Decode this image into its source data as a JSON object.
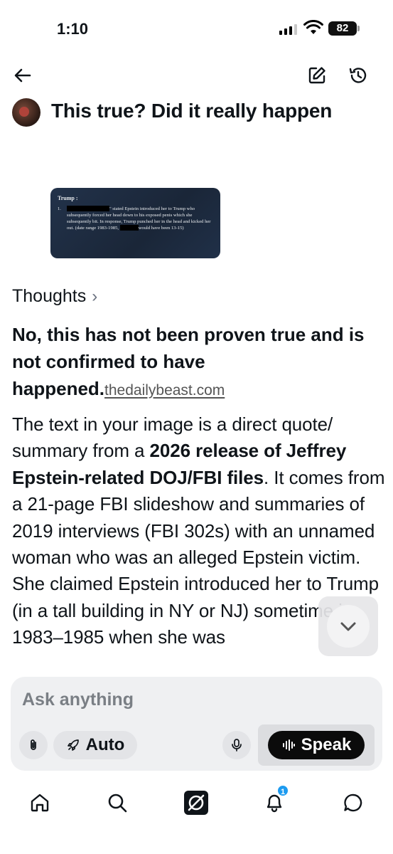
{
  "status_bar": {
    "time": "1:10",
    "battery": "82"
  },
  "header": {
    "title": "This true? Did it really happen"
  },
  "attached_image": {
    "heading": "Trump :",
    "item_number": "1.",
    "text_a": "\" stated Epstein introduced her to Trump who subsequently forced her head down to his exposed penis which she subsequently bit. In response, Trump punched her in the head and kicked her out. (date range 1983-1985,",
    "text_b": "would have been 13-15)"
  },
  "thoughts": {
    "label": "Thoughts",
    "chevron": "›"
  },
  "answer": {
    "headline": "No, this has not been proven true and is not confirmed to have happened.",
    "source_link": "thedailybeast.com",
    "body_1": "The text in your image is a direct quote/ summary from a ",
    "body_bold": "2026 release of Jeffrey Epstein-related DOJ/FBI files",
    "body_2": ". It comes from a 21-page FBI slideshow and summaries of 2019 interviews (FBI 302s) with an unnamed woman who was an alleged Epstein victim. She claimed Epstein introduced her to Trump (in a tall building in NY or NJ) sometime in 1983–1985 when she was"
  },
  "composer": {
    "placeholder": "Ask anything",
    "mode_label": "Auto",
    "speak_label": "Speak"
  },
  "bottom_nav": {
    "notification_count": "1"
  },
  "icons": {
    "back": "arrow-left-icon",
    "edit": "edit-icon",
    "history": "history-icon",
    "scroll": "chevron-down-icon",
    "attach": "paperclip-icon",
    "auto": "rocket-icon",
    "mic": "microphone-icon",
    "speak": "waveform-icon",
    "home": "home-icon",
    "search": "search-icon",
    "grok": "grok-logo-icon",
    "notifications": "bell-icon",
    "messages": "chat-icon"
  }
}
